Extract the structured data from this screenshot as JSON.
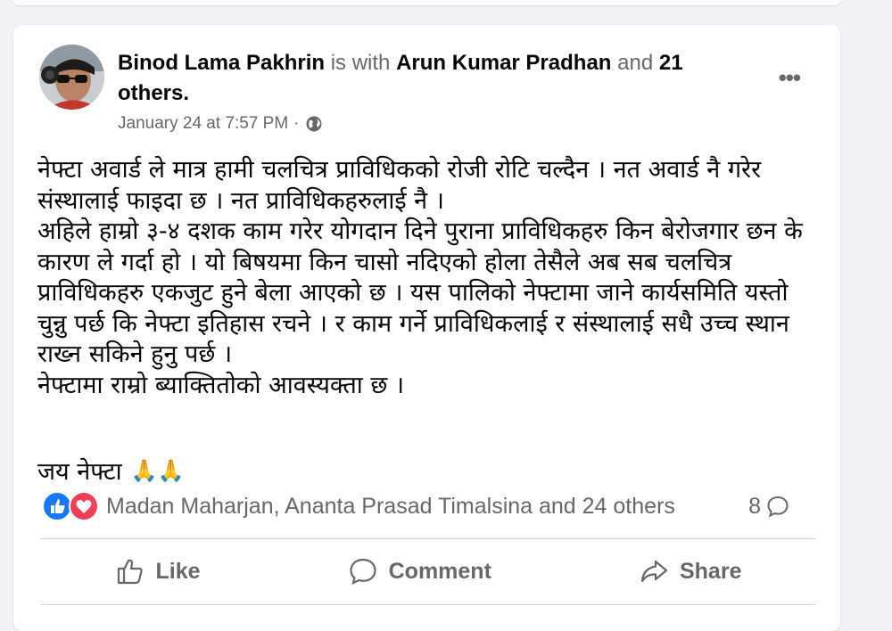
{
  "post": {
    "author": "Binod Lama Pakhrin",
    "with_text": "is with",
    "tagged": "Arun Kumar Pradhan",
    "and_text": "and",
    "others": "21 others.",
    "timestamp": "January 24 at 7:57 PM",
    "separator": "·",
    "audience_icon": "globe-icon",
    "more_icon": "•••",
    "paragraphs": [
      "नेफ्टा अवार्ड ले मात्र हामी चलचित्र प्राविधिकको रोजी रोटि चल्दैन । नत अवार्ड नै गरेर संस्थालाई फाइदा छ । नत प्राविधिकहरुलाई नै ।",
      "अहिले हाम्रो ३-४ दशक काम गरेर योगदान दिने पुराना प्राविधिकहरु किन बेरोजगार छन के कारण ले गर्दा हो । यो बिषयमा किन चासो नदिएको होला तेसैले अब सब चलचित्र प्राविधिकहरु एकजुट हुने बेला आएको छ । यस पालिको नेफ्टामा जाने कार्यसमिति यस्तो चुन्नु पर्छ कि नेफ्टा इतिहास रचने । र काम गर्ने प्राविधिकलाई र संस्थालाई सधै उच्च स्थान राख्न सकिने हुनु पर्छ ।",
      "नेफ्टामा राम्रो ब्याक्तितोको आवस्यक्ता छ ।"
    ],
    "closing": "जय नेफ्टा",
    "closing_emoji": "🙏🙏"
  },
  "reactions": {
    "names": "Madan Maharjan, Ananta Prasad Timalsina and 24 others",
    "comment_count": "8",
    "like_color": "#1877f2",
    "love_color": "#f33e58"
  },
  "actions": {
    "like": "Like",
    "comment": "Comment",
    "share": "Share"
  }
}
